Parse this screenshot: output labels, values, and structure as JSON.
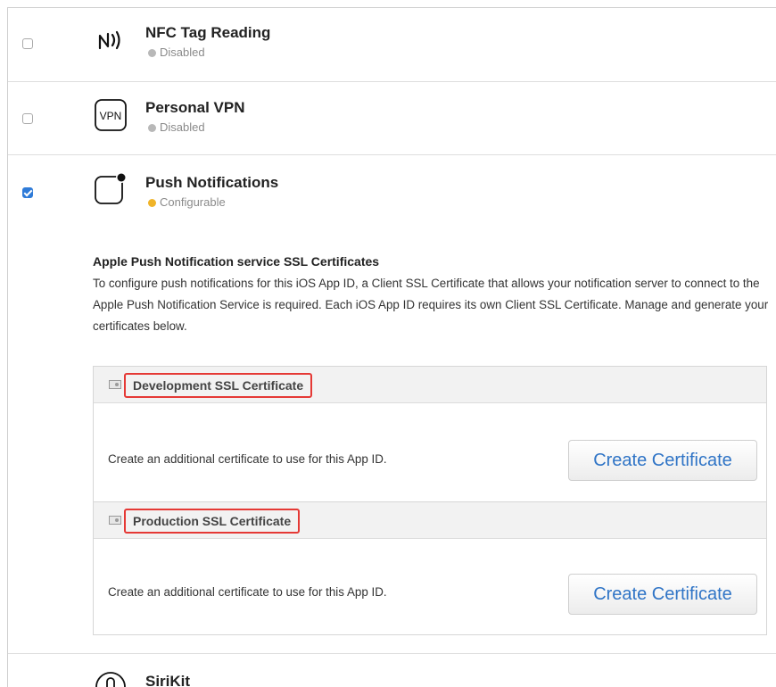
{
  "capabilities": [
    {
      "name": "NFC Tag Reading",
      "status": "Disabled",
      "icon": "nfc-icon",
      "checked": false
    },
    {
      "name": "Personal VPN",
      "status": "Disabled",
      "icon": "vpn-icon",
      "icon_text": "VPN",
      "checked": false
    },
    {
      "name": "Push Notifications",
      "status": "Configurable",
      "icon": "push-notification-icon",
      "checked": true
    },
    {
      "name": "SiriKit",
      "icon": "siri-icon",
      "checked": false
    }
  ],
  "apns": {
    "title": "Apple Push Notification service SSL Certificates",
    "description": "To configure push notifications for this iOS App ID, a Client SSL Certificate that allows your notification server to connect to the Apple Push Notification Service is required. Each iOS App ID requires its own Client SSL Certificate. Manage and generate your certificates below."
  },
  "certificates": [
    {
      "title": "Development SSL Certificate",
      "text": "Create an additional certificate to use for this App ID.",
      "button": "Create Certificate"
    },
    {
      "title": "Production SSL Certificate",
      "text": "Create an additional certificate to use for this App ID.",
      "button": "Create Certificate"
    }
  ],
  "colors": {
    "accent": "#2f7bd8",
    "link": "#2f74c6",
    "highlight": "#e53935",
    "configurable": "#f0b429",
    "disabled": "#b8b8b8"
  }
}
